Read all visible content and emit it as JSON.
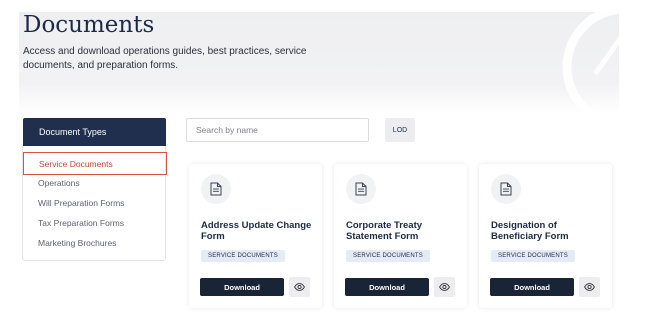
{
  "hero": {
    "title": "Documents",
    "description": "Access and download operations guides, best practices, service documents, and preparation forms."
  },
  "sidebar": {
    "header": "Document Types",
    "items": [
      {
        "label": "Service Documents",
        "active": true
      },
      {
        "label": "Operations",
        "active": false
      },
      {
        "label": "Will Preparation Forms",
        "active": false
      },
      {
        "label": "Tax Preparation Forms",
        "active": false
      },
      {
        "label": "Marketing Brochures",
        "active": false
      }
    ]
  },
  "search": {
    "placeholder": "Search by name",
    "button_label": "LOD"
  },
  "cards": [
    {
      "title": "Address Update Change Form",
      "badge": "SERVICE DOCUMENTS",
      "download_label": "Download",
      "icon": "document-icon",
      "view_icon": "eye-icon"
    },
    {
      "title": "Corporate Treaty Statement Form",
      "badge": "SERVICE DOCUMENTS",
      "download_label": "Download",
      "icon": "document-icon",
      "view_icon": "eye-icon"
    },
    {
      "title": "Designation of Beneficiary Form",
      "badge": "SERVICE DOCUMENTS",
      "download_label": "Download",
      "icon": "document-icon",
      "view_icon": "eye-icon"
    }
  ],
  "colors": {
    "navy": "#1f2f4d",
    "active_accent": "#d9533f",
    "badge_bg": "#e4ebf7",
    "button_dark": "#1a2437"
  }
}
